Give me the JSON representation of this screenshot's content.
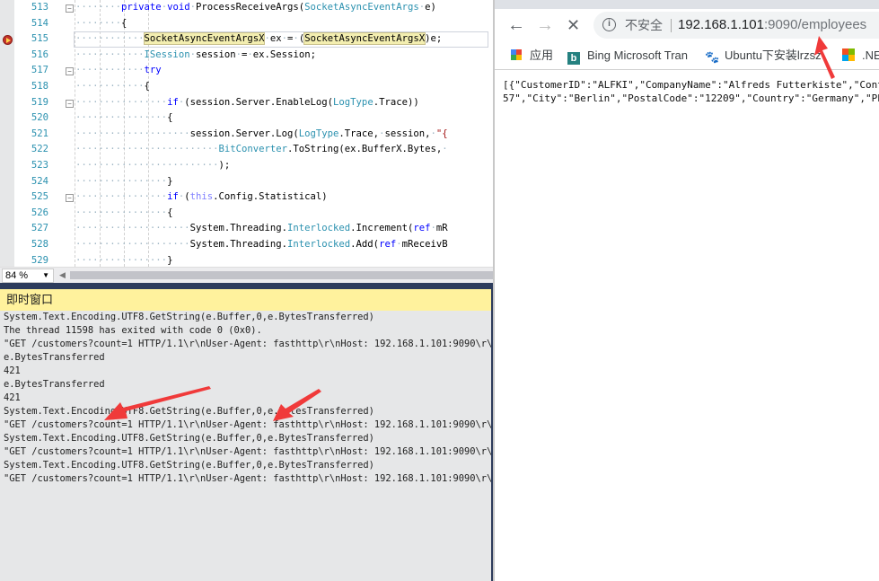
{
  "editor": {
    "lines": [
      {
        "num": "513",
        "indent": 8,
        "seg": [
          [
            "kw",
            "private"
          ],
          [
            "dot",
            "·"
          ],
          [
            "kw",
            "void"
          ],
          [
            "dot",
            "·"
          ],
          [
            "",
            "ProcessReceiveArgs("
          ],
          [
            "ty",
            "SocketAsyncEventArgs"
          ],
          [
            "dot",
            "·"
          ],
          [
            "",
            "e)"
          ]
        ]
      },
      {
        "num": "514",
        "indent": 8,
        "seg": [
          [
            "",
            "{"
          ]
        ]
      },
      {
        "num": "515",
        "indent": 12,
        "seg": [
          [
            "hl",
            "SocketAsyncEventArgsX"
          ],
          [
            "dot",
            "·"
          ],
          [
            "",
            "ex"
          ],
          [
            "dot",
            "·"
          ],
          [
            "",
            "="
          ],
          [
            "dot",
            "·"
          ],
          [
            "",
            "("
          ],
          [
            "hl",
            "SocketAsyncEventArgsX"
          ],
          [
            "",
            ")e;"
          ]
        ]
      },
      {
        "num": "516",
        "indent": 12,
        "seg": [
          [
            "ty",
            "ISession"
          ],
          [
            "dot",
            "·"
          ],
          [
            "",
            "session"
          ],
          [
            "dot",
            "·"
          ],
          [
            "",
            "="
          ],
          [
            "dot",
            "·"
          ],
          [
            "",
            "ex.Session;"
          ]
        ]
      },
      {
        "num": "517",
        "indent": 12,
        "seg": [
          [
            "kw",
            "try"
          ]
        ]
      },
      {
        "num": "518",
        "indent": 12,
        "seg": [
          [
            "",
            "{"
          ]
        ]
      },
      {
        "num": "519",
        "indent": 16,
        "seg": [
          [
            "kw",
            "if"
          ],
          [
            "dot",
            "·"
          ],
          [
            "",
            "(session.Server.EnableLog("
          ],
          [
            "ty",
            "LogType"
          ],
          [
            "",
            ".Trace))"
          ]
        ]
      },
      {
        "num": "520",
        "indent": 16,
        "seg": [
          [
            "",
            "{"
          ]
        ]
      },
      {
        "num": "521",
        "indent": 20,
        "seg": [
          [
            "",
            "session.Server.Log("
          ],
          [
            "ty",
            "LogType"
          ],
          [
            "",
            ".Trace,"
          ],
          [
            "dot",
            "·"
          ],
          [
            "",
            "session,"
          ],
          [
            "dot",
            "·"
          ],
          [
            "st",
            "\"{"
          ]
        ]
      },
      {
        "num": "522",
        "indent": 25,
        "seg": [
          [
            "ty",
            "BitConverter"
          ],
          [
            "",
            ".ToString(ex.BufferX.Bytes,"
          ],
          [
            "dot",
            "·"
          ]
        ]
      },
      {
        "num": "523",
        "indent": 25,
        "seg": [
          [
            "",
            ");"
          ]
        ]
      },
      {
        "num": "524",
        "indent": 16,
        "seg": [
          [
            "",
            "}"
          ]
        ]
      },
      {
        "num": "525",
        "indent": 16,
        "seg": [
          [
            "kw",
            "if"
          ],
          [
            "dot",
            "·"
          ],
          [
            "",
            "("
          ],
          [
            "th",
            "this"
          ],
          [
            "",
            ".Config.Statistical)"
          ]
        ]
      },
      {
        "num": "526",
        "indent": 16,
        "seg": [
          [
            "",
            "{"
          ]
        ]
      },
      {
        "num": "527",
        "indent": 20,
        "seg": [
          [
            "",
            "System.Threading."
          ],
          [
            "ty",
            "Interlocked"
          ],
          [
            "",
            ".Increment("
          ],
          [
            "kw",
            "ref"
          ],
          [
            "dot",
            "·"
          ],
          [
            "",
            "mR"
          ]
        ]
      },
      {
        "num": "528",
        "indent": 20,
        "seg": [
          [
            "",
            "System.Threading."
          ],
          [
            "ty",
            "Interlocked"
          ],
          [
            "",
            ".Add("
          ],
          [
            "kw",
            "ref"
          ],
          [
            "dot",
            "·"
          ],
          [
            "",
            "mReceivB"
          ]
        ]
      },
      {
        "num": "529",
        "indent": 16,
        "seg": [
          [
            "",
            "}"
          ]
        ]
      }
    ],
    "zoom": "84 %"
  },
  "immediate": {
    "title": "即时窗口",
    "lines": [
      "System.Text.Encoding.UTF8.GetString(e.Buffer,0,e.BytesTransferred)",
      "The thread 11598 has exited with code 0 (0x0).",
      "\"GET /customers?count=1 HTTP/1.1\\r\\nUser-Agent: fasthttp\\r\\nHost: 192.168.1.101:9090\\r\\n\\r\\",
      "e.BytesTransferred",
      "421",
      "e.BytesTransferred",
      "421",
      "System.Text.Encoding.UTF8.GetString(e.Buffer,0,e.BytesTransferred)",
      "\"GET /customers?count=1 HTTP/1.1\\r\\nUser-Agent: fasthttp\\r\\nHost: 192.168.1.101:9090\\r\\n\\r\\",
      "System.Text.Encoding.UTF8.GetString(e.Buffer,0,e.BytesTransferred)",
      "\"GET /customers?count=1 HTTP/1.1\\r\\nUser-Agent: fasthttp\\r\\nHost: 192.168.1.101:9090\\r\\n\\r\\",
      "System.Text.Encoding.UTF8.GetString(e.Buffer,0,e.BytesTransferred)",
      "\"GET /customers?count=1 HTTP/1.1\\r\\nUser-Agent: fasthttp\\r\\nHost: 192.168.1.101:9090\\r\\n\\r\\"
    ]
  },
  "browser": {
    "insecure_label": "不安全",
    "url_host": "192.168.1.101",
    "url_rest": ":9090/employees",
    "bookmarks": [
      {
        "label": "应用",
        "icon": "apps-grid-icon"
      },
      {
        "label": "Bing Microsoft Tran",
        "icon": "bing-icon"
      },
      {
        "label": "Ubuntu下安装lrzsz",
        "icon": "baidu-paw-icon"
      },
      {
        "label": ".NE",
        "icon": "microsoft-icon"
      }
    ],
    "content_lines": [
      "[{\"CustomerID\":\"ALFKI\",\"CompanyName\":\"Alfreds Futterkiste\",\"Cont",
      "57\",\"City\":\"Berlin\",\"PostalCode\":\"12209\",\"Country\":\"Germany\",\"Pho"
    ]
  },
  "colors": {
    "accent_arrow": "#f03a3a",
    "immediate_header": "#fff29d",
    "separator": "#2d3c5c"
  }
}
